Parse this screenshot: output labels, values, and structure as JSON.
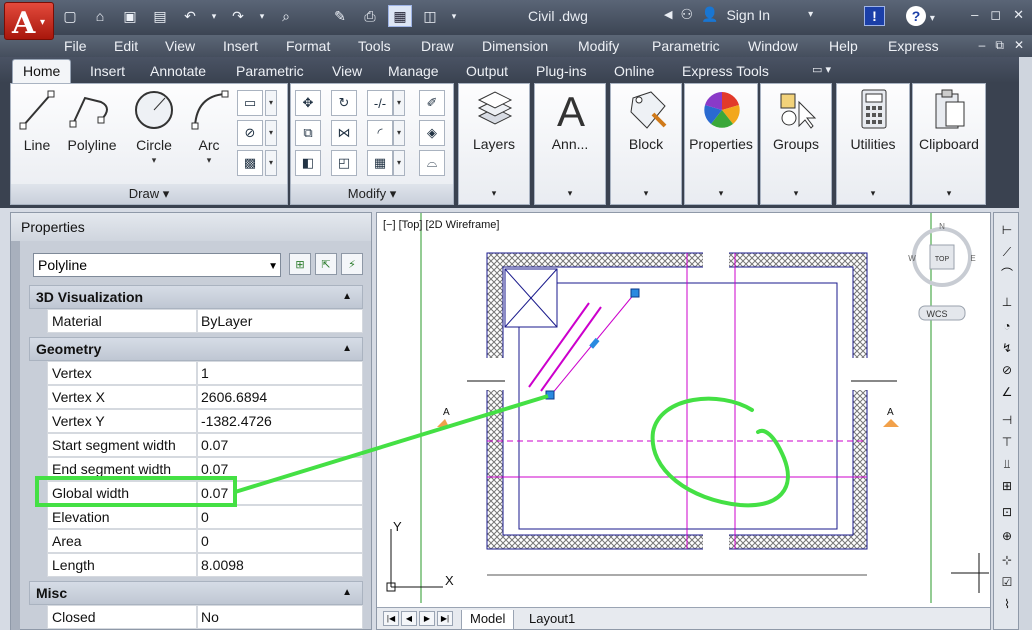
{
  "title_bar": {
    "app_logo": "A",
    "file_name": "Civil .dwg",
    "sign_in": "Sign In"
  },
  "menu": [
    "File",
    "Edit",
    "View",
    "Insert",
    "Format",
    "Tools",
    "Draw",
    "Dimension",
    "Modify",
    "Parametric",
    "Window",
    "Help",
    "Express"
  ],
  "ribbon_tabs": [
    "Home",
    "Insert",
    "Annotate",
    "Parametric",
    "View",
    "Manage",
    "Output",
    "Plug-ins",
    "Online",
    "Express Tools"
  ],
  "draw_panel": {
    "title": "Draw",
    "tools": [
      "Line",
      "Polyline",
      "Circle",
      "Arc"
    ]
  },
  "modify_panel": {
    "title": "Modify"
  },
  "ribbon_panels": [
    "Layers",
    "Ann...",
    "Block",
    "Properties",
    "Groups",
    "Utilities",
    "Clipboard"
  ],
  "properties": {
    "title": "Properties",
    "selected_type": "Polyline",
    "categories": {
      "visualization": "3D Visualization",
      "geometry": "Geometry",
      "misc": "Misc"
    },
    "material": {
      "key": "Material",
      "value": "ByLayer"
    },
    "geometry_rows": [
      {
        "key": "Vertex",
        "value": "1"
      },
      {
        "key": "Vertex X",
        "value": "2606.6894"
      },
      {
        "key": "Vertex Y",
        "value": "-1382.4726"
      },
      {
        "key": "Start segment width",
        "value": "0.07"
      },
      {
        "key": "End segment width",
        "value": "0.07"
      },
      {
        "key": "Global width",
        "value": "0.07"
      },
      {
        "key": "Elevation",
        "value": "0"
      },
      {
        "key": "Area",
        "value": "0"
      },
      {
        "key": "Length",
        "value": "8.0098"
      }
    ],
    "misc_rows": [
      {
        "key": "Closed",
        "value": "No"
      }
    ]
  },
  "viewport": {
    "label": "[−] [Top] [2D Wireframe]",
    "viewcube": {
      "face": "TOP",
      "n": "N",
      "w": "W",
      "e": "E",
      "wcs": "WCS"
    },
    "section_marks": [
      "A",
      "A"
    ],
    "ucs_x": "X",
    "ucs_y": "Y"
  },
  "layout_tabs": [
    "Model",
    "Layout1"
  ],
  "colors": {
    "highlight_green": "#44e044",
    "magenta": "#cc00cc",
    "wall_blue": "#1a1a8c",
    "green_line": "#2a9a2a"
  }
}
